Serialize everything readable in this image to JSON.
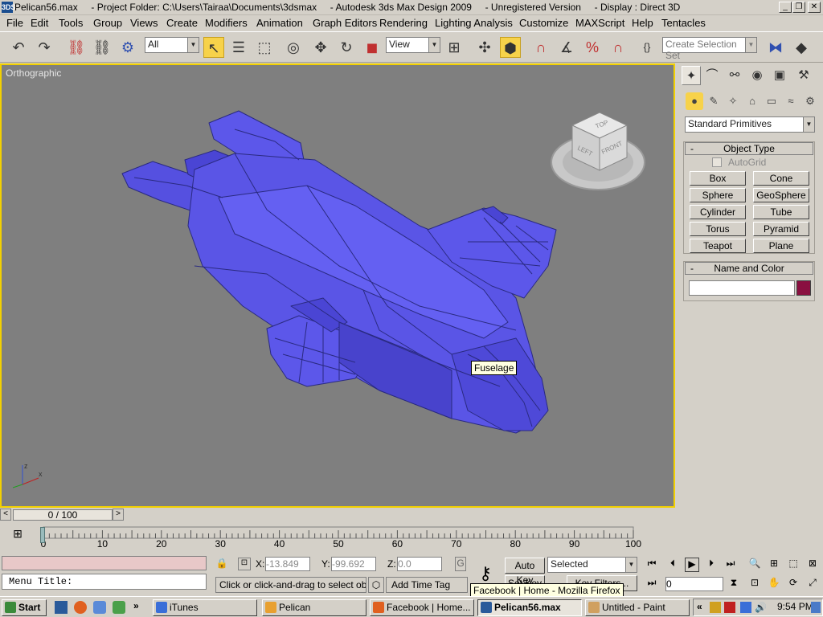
{
  "window": {
    "title": "Pelican56.max     - Project Folder: C:\\Users\\Tairaa\\Documents\\3dsmax     - Autodesk 3ds Max Design 2009     - Unregistered Version     - Display : Direct 3D",
    "app_icon": "3DS"
  },
  "menu": [
    "File",
    "Edit",
    "Tools",
    "Group",
    "Views",
    "Create",
    "Modifiers",
    "Animation",
    "Graph Editors",
    "Rendering",
    "Lighting Analysis",
    "Customize",
    "MAXScript",
    "Help",
    "Tentacles"
  ],
  "toolbar": {
    "selection_filter": "All",
    "reference_coord": "View",
    "selection_set_placeholder": "Create Selection Set"
  },
  "viewport": {
    "label": "Orthographic",
    "tooltip": "Fuselage",
    "viewcube": {
      "top": "TOP",
      "left": "LEFT",
      "front": "FRONT"
    },
    "axis": {
      "x": "x",
      "z": "z"
    },
    "colors": {
      "background": "#7f7f7f",
      "model": "#5a55e6",
      "border": "#f2d000"
    }
  },
  "command_panel": {
    "category": "Standard Primitives",
    "object_type_title": "Object Type",
    "autogrid_label": "AutoGrid",
    "buttons": [
      "Box",
      "Cone",
      "Sphere",
      "GeoSphere",
      "Cylinder",
      "Tube",
      "Torus",
      "Pyramid",
      "Teapot",
      "Plane"
    ],
    "name_color_title": "Name and Color",
    "name_value": "",
    "object_color": "#8a1040",
    "collapse_symbol": "-"
  },
  "time": {
    "slider_label": "0 / 100",
    "ticks": [
      "0",
      "10",
      "20",
      "30",
      "40",
      "50",
      "60",
      "70",
      "80",
      "90",
      "100"
    ],
    "frame_value": "0"
  },
  "status": {
    "maxscript_listener": "Menu Title:",
    "prompt": "Click or click-and-drag to select objects",
    "x_label": "X:",
    "x_value": "-13.849",
    "y_label": "Y:",
    "y_value": "-99.692",
    "z_label": "Z:",
    "z_value": "0.0",
    "grid_label": "G",
    "add_time_tag": "Add Time Tag",
    "auto_key": "Auto Key",
    "set_key": "Set Key",
    "key_mode": "Selected",
    "key_filters": "Key Filters...",
    "firefox_tooltip": "Facebook | Home - Mozilla Firefox"
  },
  "taskbar": {
    "start": "Start",
    "overflow": "»",
    "tasks": [
      {
        "label": "iTunes",
        "color": "#3a6ed8"
      },
      {
        "label": "Pelican",
        "color": "#e8a030"
      },
      {
        "label": "Facebook | Home...",
        "color": "#e06020"
      },
      {
        "label": "Pelican56.max",
        "color": "#2a5a9a"
      },
      {
        "label": "Untitled - Paint",
        "color": "#d0a060"
      }
    ],
    "tray_overflow": "«",
    "clock": "9:54 PM"
  }
}
